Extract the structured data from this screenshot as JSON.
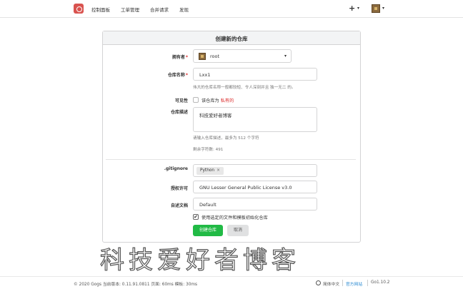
{
  "navbar": {
    "items": [
      "控制面板",
      "工单管理",
      "合并请求",
      "发现"
    ],
    "plus": "+",
    "caret": "▾"
  },
  "form": {
    "title": "创建新的仓库",
    "owner": {
      "label": "拥有者",
      "required": "*",
      "value": "root"
    },
    "repo_name": {
      "label": "仓库名称",
      "required": "*",
      "value": "Lxx1",
      "help": "伟大的仓库名称一般都较短、令人深刻并且 独一无二 的。"
    },
    "visibility": {
      "label": "可见性",
      "checkbox_label": "该仓库为",
      "private_text": "私有的"
    },
    "description": {
      "label": "仓库描述",
      "value": "科技爱好者博客",
      "help": "请输入仓库描述，最多为 512 个字符",
      "remaining": "剩余字符数: 491"
    },
    "gitignore": {
      "label": ".gitignore",
      "tag": "Python",
      "tag_remove": "×"
    },
    "license": {
      "label": "授权许可",
      "value": "GNU Lesser General Public License v3.0"
    },
    "readme": {
      "label": "自述文档",
      "value": "Default"
    },
    "init": {
      "label": "使用选定的文件和模板初始化仓库",
      "check": "✔"
    },
    "submit_label": "创建仓库",
    "cancel_label": "取消"
  },
  "watermark": "科技爱好者博客",
  "footer": {
    "left": "© 2020 Gogs 当前版本: 0.11.91.0811 页面: 60ms 模板: 30ms",
    "language": "简体中文",
    "website": "官方网站",
    "go_version": "Go1.10.2"
  },
  "colors": {
    "brand": "#d9534f",
    "primary": "#21ba45",
    "required": "#db2828",
    "link": "#2185d0"
  }
}
